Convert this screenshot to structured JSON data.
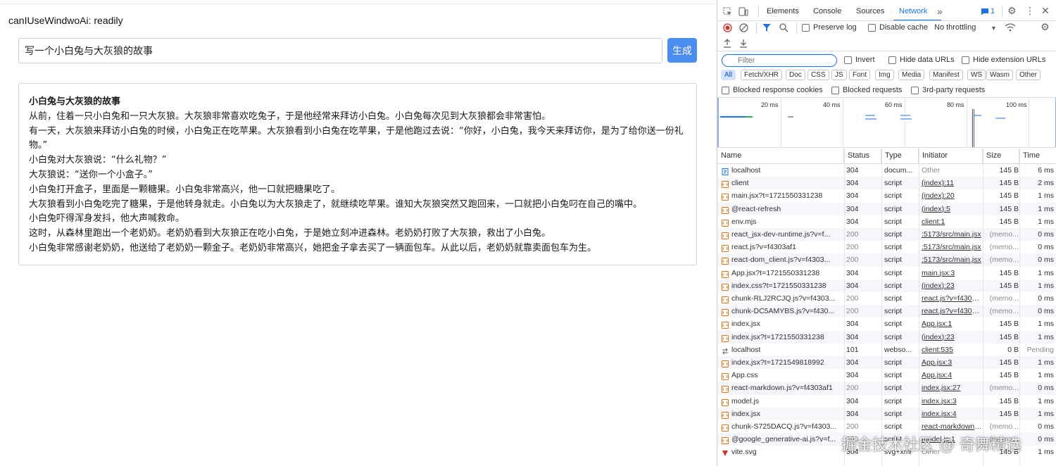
{
  "app": {
    "status": "canIUseWindwoAi: readily",
    "prompt_value": "写一个小白兔与大灰狼的故事",
    "generate_label": "生成",
    "story": {
      "title": "小白兔与大灰狼的故事",
      "lines": [
        "从前，住着一只小白兔和一只大灰狼。大灰狼非常喜欢吃兔子，于是他经常来拜访小白兔。小白兔每次见到大灰狼都会非常害怕。",
        "有一天，大灰狼来拜访小白兔的时候，小白兔正在吃苹果。大灰狼看到小白兔在吃苹果，于是他跑过去说：“你好，小白兔，我今天来拜访你，是为了给你送一份礼物。”",
        "小白兔对大灰狼说：“什么礼物？”",
        "大灰狼说：“送你一个小盒子。”",
        "小白兔打开盒子，里面是一颗糖果。小白兔非常高兴，他一口就把糖果吃了。",
        "大灰狼看到小白兔吃完了糖果，于是他转身就走。小白兔以为大灰狼走了，就继续吃苹果。谁知大灰狼突然又跑回来，一口就把小白兔叼在自己的嘴中。",
        "小白兔吓得浑身发抖，他大声喊救命。",
        "这时，从森林里跑出一个老奶奶。老奶奶看到大灰狼正在吃小白兔，于是她立刻冲进森林。老奶奶打败了大灰狼，救出了小白兔。",
        "小白兔非常感谢老奶奶，他送给了老奶奶一颗金子。老奶奶非常高兴，她把金子拿去买了一辆面包车。从此以后，老奶奶就靠卖面包车为生。"
      ]
    }
  },
  "devtools": {
    "tabs": [
      "Elements",
      "Console",
      "Sources",
      "Network"
    ],
    "active_tab": "Network",
    "more_tabs": "»",
    "issues_count": "1",
    "toolbar": {
      "preserve_log": "Preserve log",
      "disable_cache": "Disable cache",
      "throttling": "No throttling"
    },
    "filter": {
      "placeholder": "Filter",
      "invert": "Invert",
      "hide_data_urls": "Hide data URLs",
      "hide_extension_urls": "Hide extension URLs"
    },
    "type_chips": [
      "All",
      "Fetch/XHR",
      "Doc",
      "CSS",
      "JS",
      "Font",
      "Img",
      "Media",
      "Manifest",
      "WS",
      "Wasm",
      "Other"
    ],
    "active_chip": "All",
    "blocked": {
      "blocked_cookies": "Blocked response cookies",
      "blocked_requests": "Blocked requests",
      "third_party": "3rd-party requests"
    },
    "overview_ticks": [
      "20 ms",
      "40 ms",
      "60 ms",
      "80 ms",
      "100 ms"
    ],
    "columns": [
      "Name",
      "Status",
      "Type",
      "Initiator",
      "Size",
      "Time"
    ],
    "requests": [
      {
        "name": "localhost",
        "status": "304",
        "type": "docum...",
        "initiator": "Other",
        "size": "145 B",
        "time": "6 ms",
        "icon": "doc"
      },
      {
        "name": "client",
        "status": "304",
        "type": "script",
        "initiator": "(index):11",
        "size": "145 B",
        "time": "2 ms",
        "icon": "script"
      },
      {
        "name": "main.jsx?t=1721550331238",
        "status": "304",
        "type": "script",
        "initiator": "(index):20",
        "size": "145 B",
        "time": "1 ms",
        "icon": "script"
      },
      {
        "name": "@react-refresh",
        "status": "304",
        "type": "script",
        "initiator": "(index):5",
        "size": "145 B",
        "time": "1 ms",
        "icon": "script"
      },
      {
        "name": "env.mjs",
        "status": "304",
        "type": "script",
        "initiator": "client:1",
        "size": "145 B",
        "time": "1 ms",
        "icon": "script"
      },
      {
        "name": "react_jsx-dev-runtime.js?v=f...",
        "status": "200",
        "type": "script",
        "initiator": ":5173/src/main.jsx",
        "size": "(memo...",
        "time": "0 ms",
        "icon": "script"
      },
      {
        "name": "react.js?v=f4303af1",
        "status": "200",
        "type": "script",
        "initiator": ":5173/src/main.jsx",
        "size": "(memo...",
        "time": "0 ms",
        "icon": "script"
      },
      {
        "name": "react-dom_client.js?v=f4303...",
        "status": "200",
        "type": "script",
        "initiator": ":5173/src/main.jsx",
        "size": "(memo...",
        "time": "0 ms",
        "icon": "script"
      },
      {
        "name": "App.jsx?t=1721550331238",
        "status": "304",
        "type": "script",
        "initiator": "main.jsx:3",
        "size": "145 B",
        "time": "1 ms",
        "icon": "script"
      },
      {
        "name": "index.css?t=1721550331238",
        "status": "304",
        "type": "script",
        "initiator": "(index):23",
        "size": "145 B",
        "time": "1 ms",
        "icon": "script"
      },
      {
        "name": "chunk-RLJ2RCJQ.js?v=f4303...",
        "status": "200",
        "type": "script",
        "initiator": "react.js?v=f4303af1",
        "size": "(memo...",
        "time": "0 ms",
        "icon": "script"
      },
      {
        "name": "chunk-DC5AMYBS.js?v=f430...",
        "status": "200",
        "type": "script",
        "initiator": "react.js?v=f4303af1",
        "size": "(memo...",
        "time": "0 ms",
        "icon": "script"
      },
      {
        "name": "index.jsx",
        "status": "304",
        "type": "script",
        "initiator": "App.jsx:1",
        "size": "145 B",
        "time": "1 ms",
        "icon": "script"
      },
      {
        "name": "index.jsx?t=1721550331238",
        "status": "304",
        "type": "script",
        "initiator": "(index):23",
        "size": "145 B",
        "time": "1 ms",
        "icon": "script"
      },
      {
        "name": "localhost",
        "status": "101",
        "type": "websо...",
        "initiator": "client:535",
        "size": "0 B",
        "time": "Pending",
        "icon": "ws"
      },
      {
        "name": "index.jsx?t=1721549818992",
        "status": "304",
        "type": "script",
        "initiator": "App.jsx:3",
        "size": "145 B",
        "time": "1 ms",
        "icon": "script"
      },
      {
        "name": "App.css",
        "status": "304",
        "type": "script",
        "initiator": "App.jsx:4",
        "size": "145 B",
        "time": "1 ms",
        "icon": "script"
      },
      {
        "name": "react-markdown.js?v=f4303af1",
        "status": "200",
        "type": "script",
        "initiator": "index.jsx:27",
        "size": "(memo...",
        "time": "0 ms",
        "icon": "script"
      },
      {
        "name": "model.js",
        "status": "304",
        "type": "script",
        "initiator": "index.jsx:3",
        "size": "145 B",
        "time": "1 ms",
        "icon": "script"
      },
      {
        "name": "index.jsx",
        "status": "304",
        "type": "script",
        "initiator": "index.jsx:4",
        "size": "145 B",
        "time": "1 ms",
        "icon": "script"
      },
      {
        "name": "chunk-S725DACQ.js?v=f4303...",
        "status": "200",
        "type": "script",
        "initiator": "react-markdown.js?v",
        "size": "(memo...",
        "time": "0 ms",
        "icon": "script"
      },
      {
        "name": "@google_generative-ai.js?v=f...",
        "status": "200",
        "type": "script",
        "initiator": "model.js:1",
        "size": "(memo...",
        "time": "0 ms",
        "icon": "script"
      },
      {
        "name": "vite.svg",
        "status": "304",
        "type": "svg+xml",
        "initiator": "Other",
        "size": "145 B",
        "time": "1 ms",
        "icon": "svg"
      }
    ],
    "colors": {
      "accent": "#1a73e8",
      "script_icon": "#e8710a",
      "doc_icon": "#1a73e8",
      "svg_icon": "#d93025"
    }
  },
  "watermark": "掘金技术社区 @ 奇舞精选"
}
